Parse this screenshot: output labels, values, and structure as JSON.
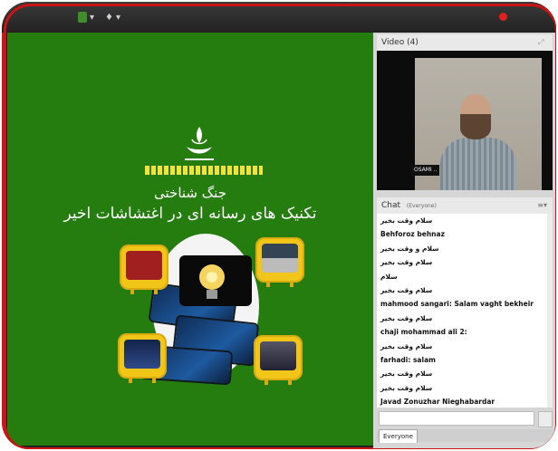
{
  "video_pod": {
    "title": "Video",
    "count": "(4)",
    "speaker_tag": "OSAMI .."
  },
  "chat_pod": {
    "title": "Chat",
    "audience": "(Everyone)"
  },
  "presentation": {
    "line1": "جنگ شناختی",
    "line2": "تکنیک های رسانه ای در اغتشاشات اخیر"
  },
  "messages": [
    "سلام وقت بخیر",
    "Behforoz behnaz",
    "سلام و وقت بخیر",
    "سلام وقت بخیر",
    "سلام",
    "سلام وقت بخیر",
    "mahmood sangari: Salam vaght bekheir",
    "سلام وقت بخیر",
    "chaji mohammad ali 2:",
    "سلام وقت بخیر",
    "farhadi: salam",
    "سلام وقت بخیر",
    "سلام وقت بخیر",
    "Javad Zonuzhar Nieghabardar",
    "سلام وقت بخیر"
  ],
  "chat_input": {
    "placeholder": ""
  },
  "tab": {
    "label": "Everyone"
  },
  "colors": {
    "stage": "#257d10",
    "frame": "#c81414",
    "accent": "#f2c618"
  }
}
